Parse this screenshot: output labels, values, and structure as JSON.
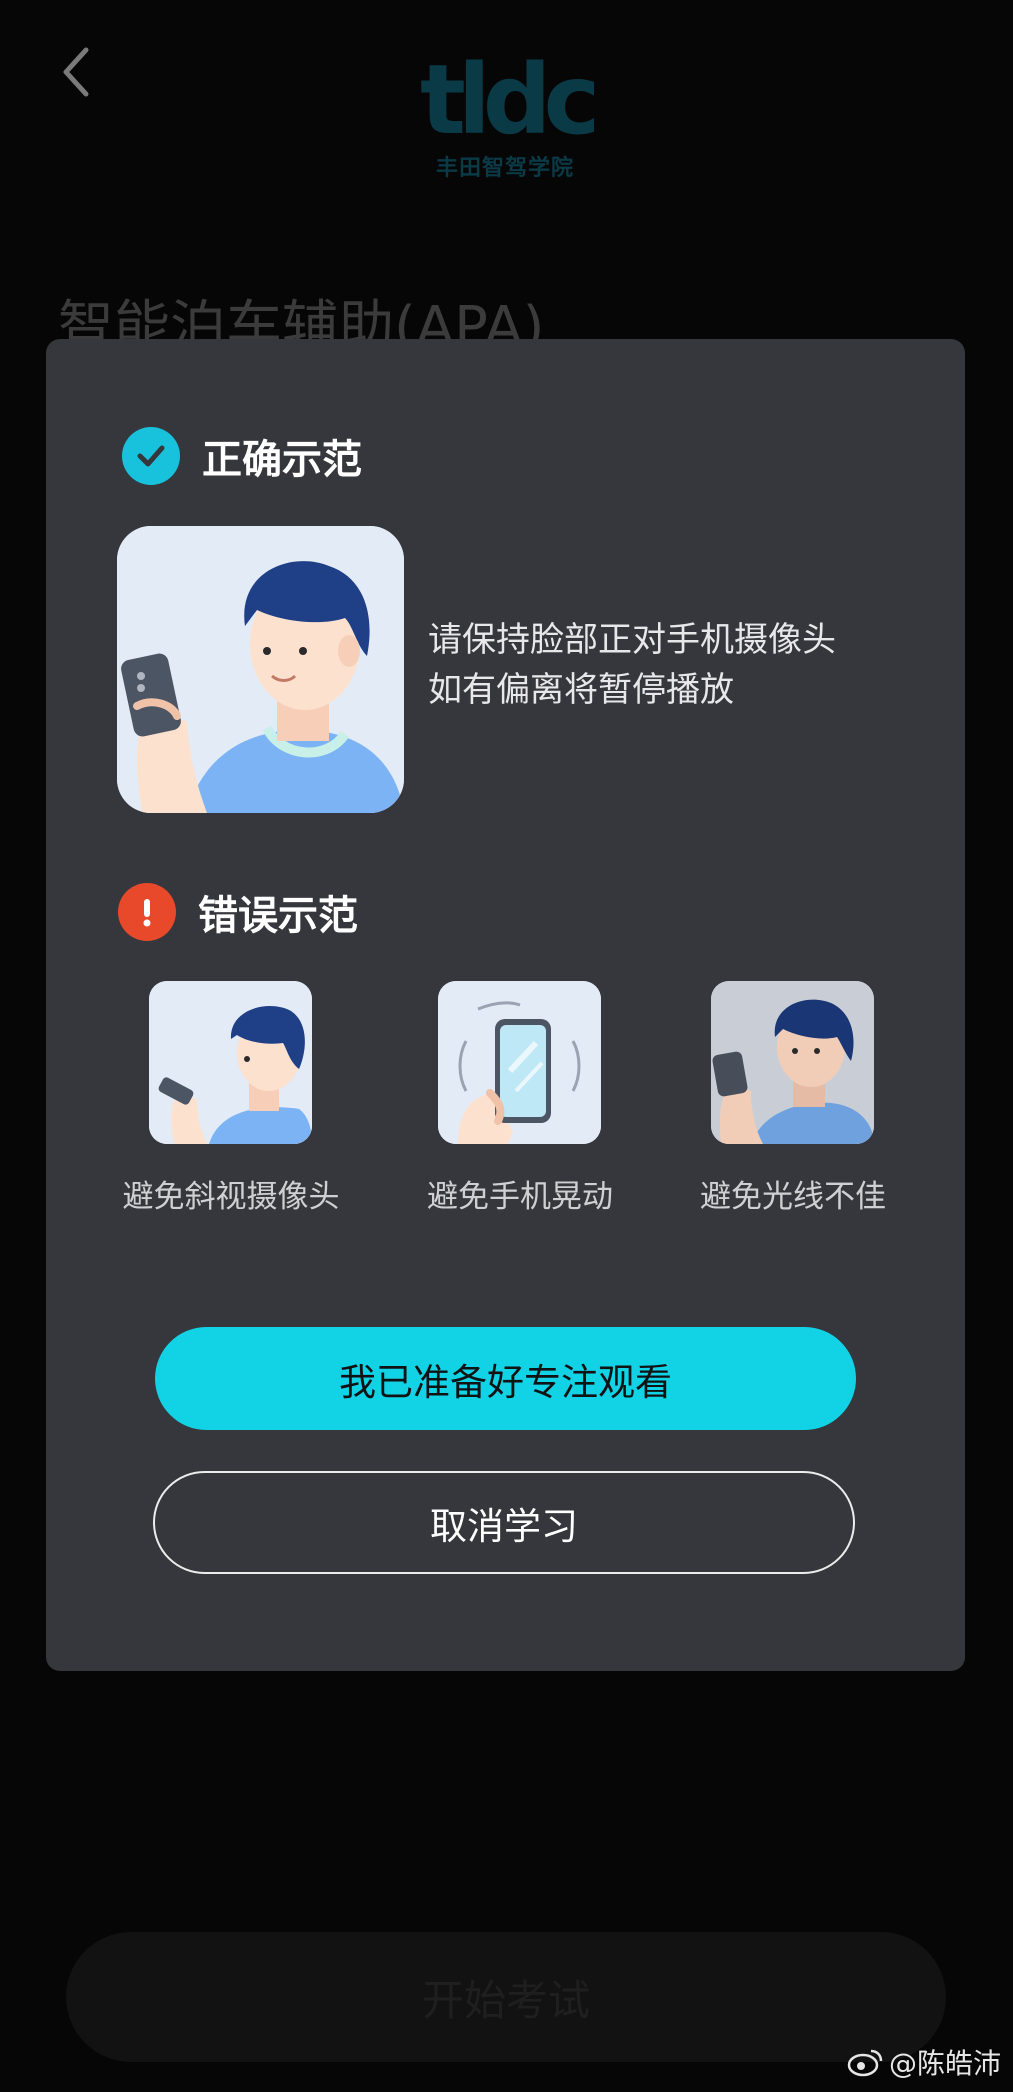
{
  "header": {
    "back_icon": "chevron-left-icon",
    "logo_mark": "tldc",
    "logo_subtitle": "丰田智驾学院"
  },
  "course": {
    "title": "智能泊车辅助(APA)"
  },
  "dialog": {
    "correct": {
      "icon": "check-icon",
      "title": "正确示范",
      "tip_line1": "请保持脸部正对手机摄像头",
      "tip_line2": "如有偏离将暂停播放"
    },
    "wrong": {
      "icon": "exclamation-icon",
      "title": "错误示范",
      "items": [
        {
          "label": "避免斜视摄像头",
          "icon": "side-view-illustration"
        },
        {
          "label": "避免手机晃动",
          "icon": "shaking-phone-illustration"
        },
        {
          "label": "避免光线不佳",
          "icon": "dim-light-illustration"
        }
      ]
    },
    "confirm_label": "我已准备好专注观看",
    "cancel_label": "取消学习"
  },
  "footer": {
    "start_exam_label": "开始考试"
  },
  "watermark": {
    "text": "@陈皓沛",
    "icon": "weibo-icon"
  },
  "colors": {
    "accent": "#12d3e6",
    "ok": "#18c2dc",
    "error": "#e8492b",
    "dialog_bg": "#36373c"
  }
}
